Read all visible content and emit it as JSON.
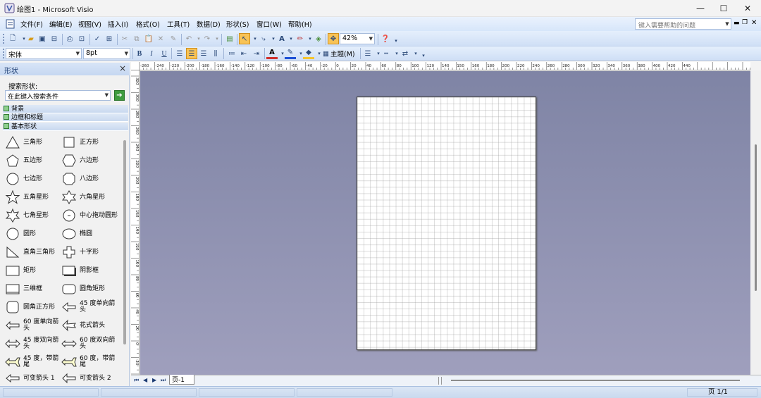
{
  "window": {
    "title": "绘图1 - Microsoft Visio",
    "controls": {
      "minimize": "—",
      "maximize": "☐",
      "close": "✕"
    }
  },
  "menubar": {
    "items": [
      "文件(F)",
      "编辑(E)",
      "视图(V)",
      "插入(I)",
      "格式(O)",
      "工具(T)",
      "数据(D)",
      "形状(S)",
      "窗口(W)",
      "帮助(H)"
    ],
    "help_placeholder": "键入需要帮助的问题"
  },
  "toolbar_standard": {
    "zoom": "42%"
  },
  "toolbar_format": {
    "font": "宋体",
    "size": "8pt",
    "bold": "B",
    "italic": "I",
    "underline": "U",
    "theme": "主题(M)"
  },
  "sidebar": {
    "title": "形状",
    "close": "×",
    "search_label": "搜索形状:",
    "search_placeholder": "在此键入搜索条件",
    "categories": [
      "背景",
      "边框和标题",
      "基本形状"
    ],
    "shapes": [
      {
        "label": "三角形",
        "icon": "triangle-icon"
      },
      {
        "label": "正方形",
        "icon": "square-icon"
      },
      {
        "label": "五边形",
        "icon": "pentagon-icon"
      },
      {
        "label": "六边形",
        "icon": "hexagon-icon"
      },
      {
        "label": "七边形",
        "icon": "heptagon-icon"
      },
      {
        "label": "八边形",
        "icon": "octagon-icon"
      },
      {
        "label": "五角星形",
        "icon": "five-point-star-icon"
      },
      {
        "label": "六角星形",
        "icon": "six-point-star-icon"
      },
      {
        "label": "七角星形",
        "icon": "seven-point-star-icon"
      },
      {
        "label": "中心拖动圆形",
        "icon": "center-drag-circle-icon"
      },
      {
        "label": "圆形",
        "icon": "circle-icon"
      },
      {
        "label": "椭圆",
        "icon": "ellipse-icon"
      },
      {
        "label": "直角三角形",
        "icon": "right-triangle-icon"
      },
      {
        "label": "十字形",
        "icon": "cross-icon"
      },
      {
        "label": "矩形",
        "icon": "rectangle-icon"
      },
      {
        "label": "阴影框",
        "icon": "shadow-box-icon"
      },
      {
        "label": "三维框",
        "icon": "3d-box-icon"
      },
      {
        "label": "圆角矩形",
        "icon": "rounded-rectangle-icon"
      },
      {
        "label": "圆角正方形",
        "icon": "rounded-square-icon"
      },
      {
        "label": "45 度单向箭头",
        "icon": "arrow-45-single-icon"
      },
      {
        "label": "60 度单向箭头",
        "icon": "arrow-60-single-icon"
      },
      {
        "label": "花式箭头",
        "icon": "fancy-arrow-icon"
      },
      {
        "label": "45 度双向箭头",
        "icon": "arrow-45-double-icon"
      },
      {
        "label": "60 度双向箭头",
        "icon": "arrow-60-double-icon"
      },
      {
        "label": "45 度，带箭尾",
        "icon": "arrow-45-tail-icon"
      },
      {
        "label": "60 度，带箭尾",
        "icon": "arrow-60-tail-icon"
      },
      {
        "label": "可变箭头 1",
        "icon": "variable-arrow-1-icon"
      },
      {
        "label": "可变箭头 2",
        "icon": "variable-arrow-2-icon"
      }
    ]
  },
  "ruler": {
    "top_labels": [
      "-260",
      "-240",
      "-220",
      "-200",
      "-180",
      "-160",
      "-140",
      "-120",
      "-100",
      "-80",
      "-60",
      "-40",
      "-20",
      "0",
      "20",
      "40",
      "60",
      "80",
      "100",
      "120",
      "140",
      "150",
      "160",
      "180",
      "200",
      "220",
      "240",
      "260",
      "280",
      "300",
      "320",
      "340",
      "360",
      "380",
      "400",
      "420",
      "440"
    ],
    "left_labels": [
      "320",
      "300",
      "280",
      "260",
      "240",
      "220",
      "200",
      "180",
      "160",
      "140",
      "120",
      "100",
      "80",
      "60",
      "40",
      "20",
      "0",
      "-20"
    ]
  },
  "pagebar": {
    "tab": "页-1",
    "nav": [
      "⏮",
      "◀",
      "▶",
      "⏭"
    ]
  },
  "statusbar": {
    "page": "页 1/1"
  },
  "colors": {
    "canvas": "#8b8cad",
    "accent": "#f8c356",
    "chrome": "#d7e6fa"
  }
}
